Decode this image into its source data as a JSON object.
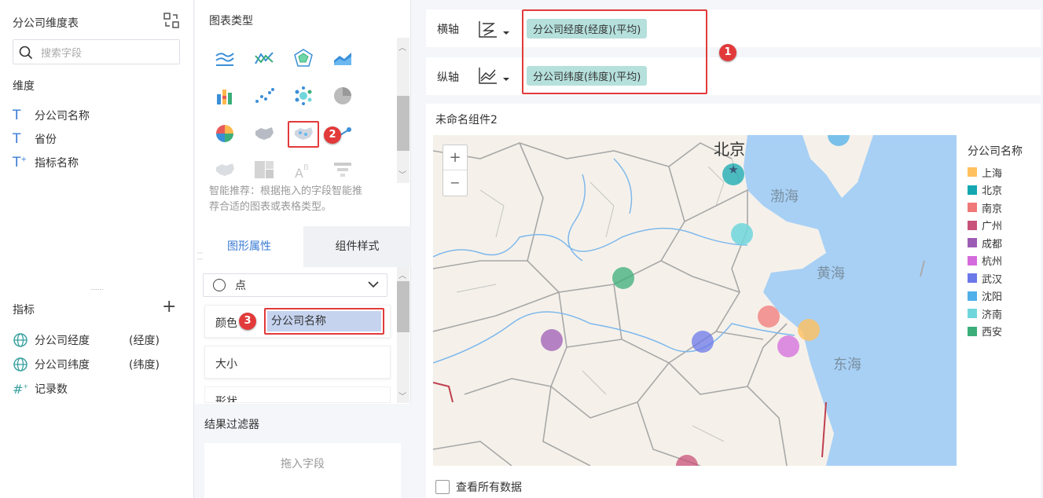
{
  "left": {
    "title": "分公司维度表",
    "search_placeholder": "搜索字段",
    "dimension_header": "维度",
    "dimensions": [
      {
        "icon": "text-icon",
        "label": "分公司名称"
      },
      {
        "icon": "text-icon",
        "label": "省份"
      },
      {
        "icon": "text-indicator-icon",
        "label": "指标名称"
      }
    ],
    "measure_header": "指标",
    "measures": [
      {
        "icon": "globe-icon",
        "label": "分公司经度",
        "suffix": "(经度)"
      },
      {
        "icon": "globe-icon",
        "label": "分公司纬度",
        "suffix": "(纬度)"
      },
      {
        "icon": "count-icon",
        "label": "记录数",
        "suffix": ""
      }
    ]
  },
  "mid": {
    "chart_type_title": "图表类型",
    "recommend_text_1": "智能推荐：根据拖入的字段智能推",
    "recommend_text_2": "荐合适的图表或表格类型。",
    "tabs": [
      "图形属性",
      "组件样式"
    ],
    "shape_select": "点",
    "props": {
      "color_label": "颜色",
      "color_field": "分公司名称",
      "size_label": "大小",
      "shape_label": "形状"
    },
    "filter_title": "结果过滤器",
    "filter_placeholder": "拖入字段",
    "badges": {
      "b2": "2",
      "b3": "3"
    }
  },
  "right": {
    "x_axis_label": "横轴",
    "x_axis_field": "分公司经度(经度)(平均)",
    "y_axis_label": "纵轴",
    "y_axis_field": "分公司纬度(纬度)(平均)",
    "badge1": "1",
    "widget_title": "未命名组件2",
    "zoom_in": "+",
    "zoom_out": "−",
    "view_all": "查看所有数据"
  },
  "map": {
    "labels": {
      "beijing": "北京",
      "bohai": "渤海",
      "huanghai": "黄海",
      "donghai": "东海"
    },
    "legend_title": "分公司名称",
    "legend": [
      {
        "name": "上海",
        "color": "#ffc15e"
      },
      {
        "name": "北京",
        "color": "#13a8b0"
      },
      {
        "name": "南京",
        "color": "#f07878"
      },
      {
        "name": "广州",
        "color": "#c8527a"
      },
      {
        "name": "成都",
        "color": "#9d5cb4"
      },
      {
        "name": "杭州",
        "color": "#d46bdc"
      },
      {
        "name": "武汉",
        "color": "#6b78e8"
      },
      {
        "name": "沈阳",
        "color": "#4fb0ea"
      },
      {
        "name": "济南",
        "color": "#6fd6dc"
      },
      {
        "name": "西安",
        "color": "#3cae7a"
      }
    ]
  },
  "colors": {
    "accent": "#3a7bd5",
    "red": "#e23a3a",
    "chip": "#b5e0dc",
    "sea": "#a8d0f5",
    "land": "#f5f1ea"
  }
}
